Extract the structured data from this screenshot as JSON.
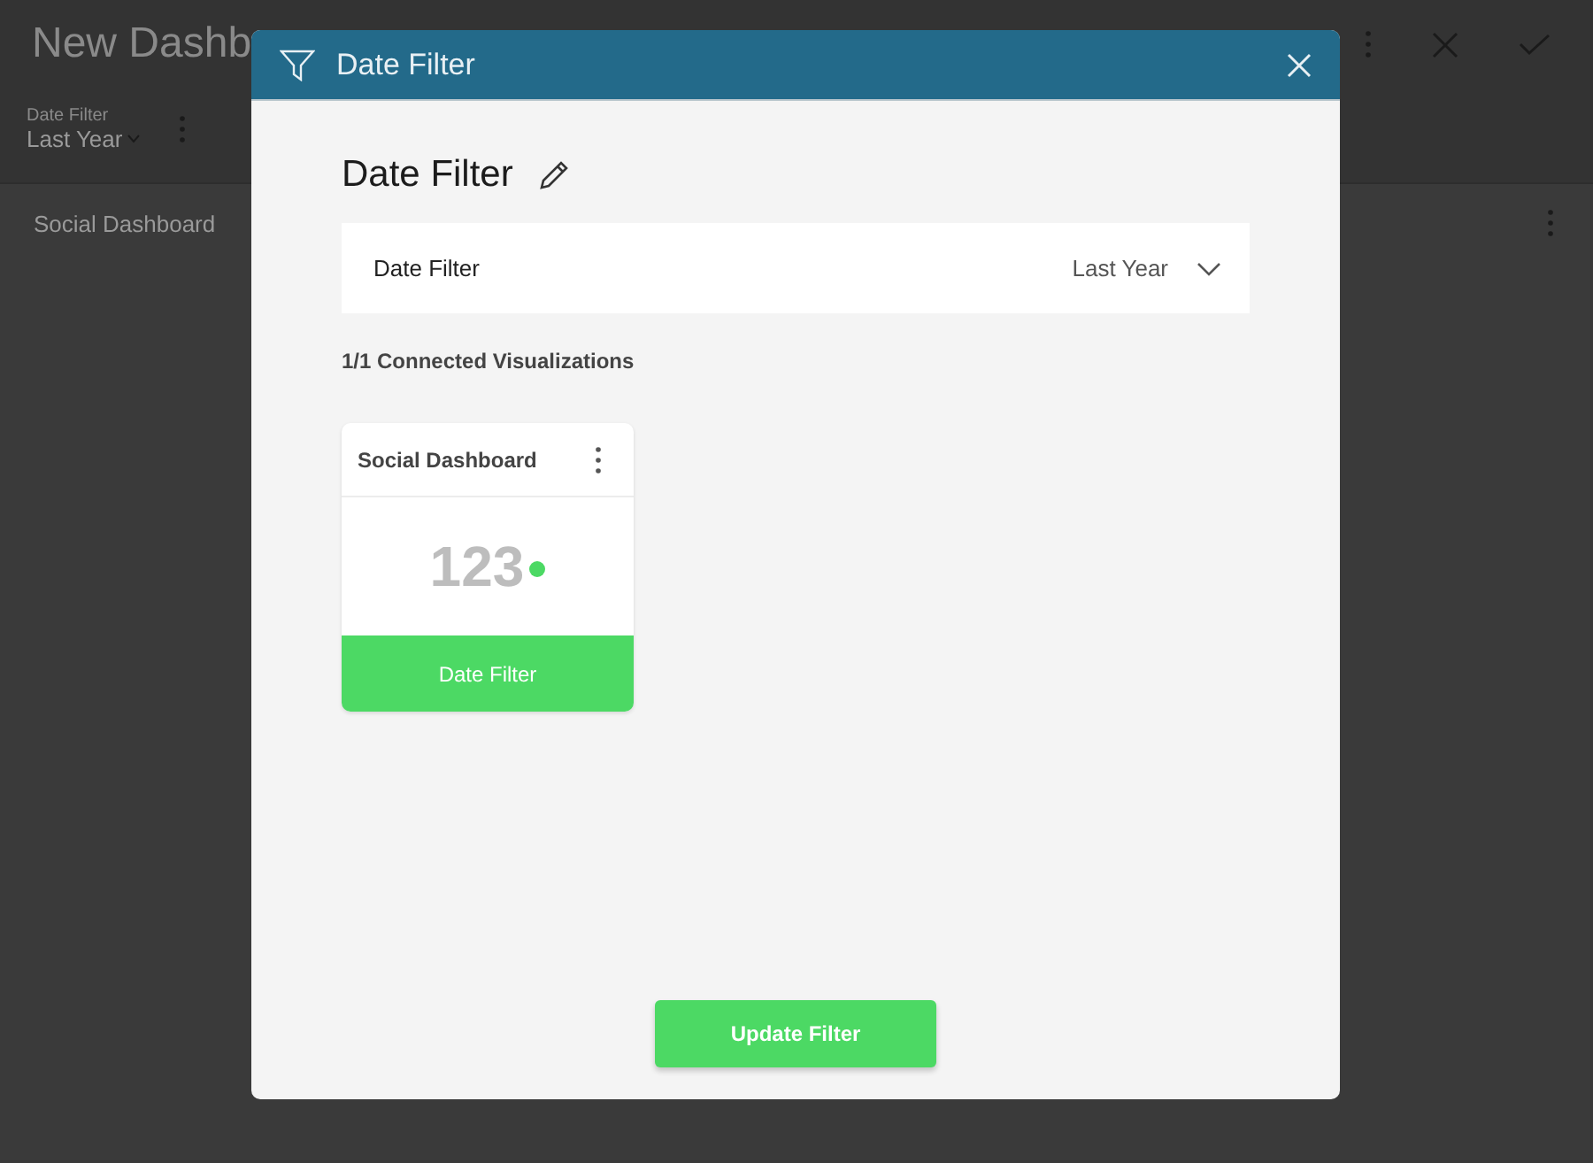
{
  "background": {
    "title": "New Dashb",
    "filter": {
      "label": "Date Filter",
      "value": "Last Year"
    },
    "widget_title": "Social Dashboard"
  },
  "dialog": {
    "title": "Date Filter",
    "heading": "Date Filter",
    "filter_field": {
      "label": "Date Filter",
      "value": "Last Year"
    },
    "connected_label": "1/1 Connected Visualizations",
    "visualizations": [
      {
        "title": "Social Dashboard",
        "value": "123",
        "filter_label": "Date Filter"
      }
    ],
    "update_button": "Update Filter"
  }
}
